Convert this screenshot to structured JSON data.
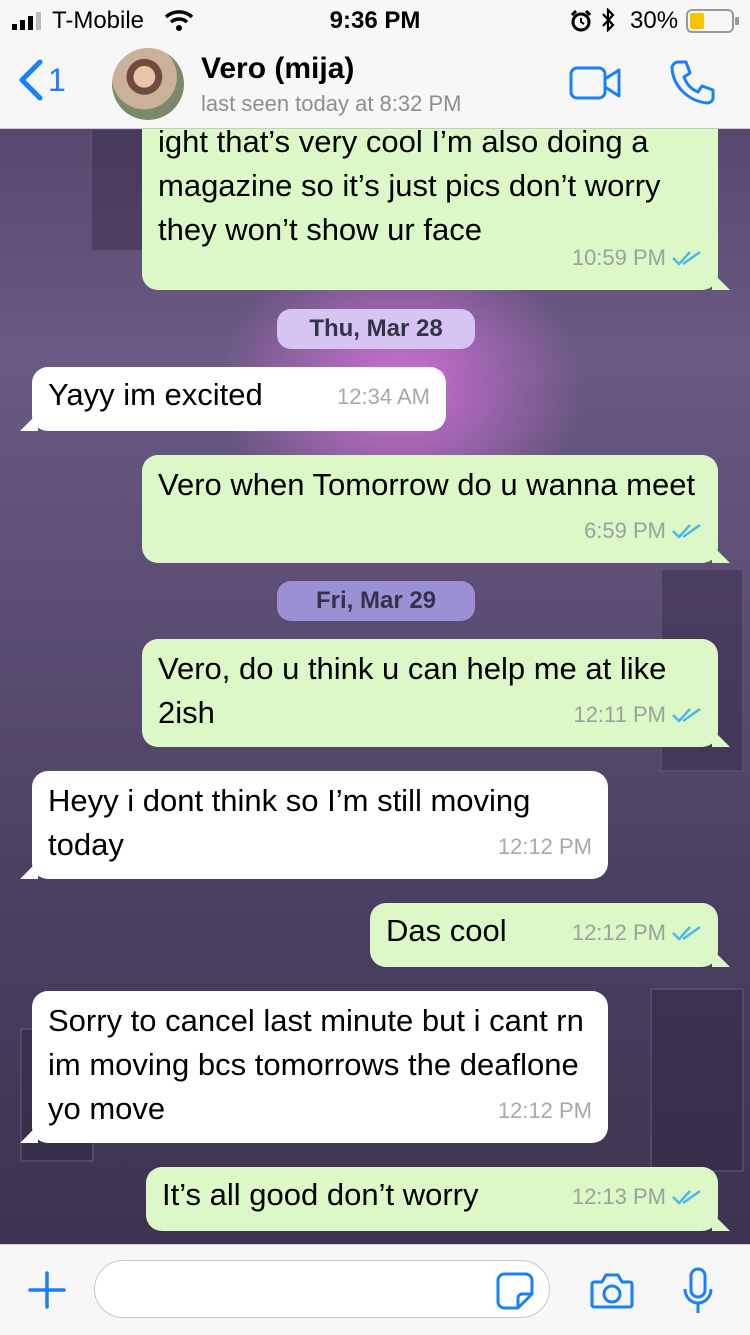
{
  "status_bar": {
    "carrier": "T-Mobile",
    "time": "9:36 PM",
    "battery": "30%"
  },
  "header": {
    "back_count": "1",
    "contact_name": "Vero (mija)",
    "last_seen": "last seen today at 8:32 PM"
  },
  "messages": [
    {
      "text": "ight that’s very cool I’m also doing a magazine so it’s just pics don’t worry they won’t show ur face",
      "time": "10:59 PM"
    },
    {
      "text": "Yayy im excited",
      "time": "12:34 AM"
    },
    {
      "text": "Vero when Tomorrow do u wanna meet",
      "time": "6:59 PM"
    },
    {
      "text": "Vero, do u think u can help me at like 2ish",
      "time": "12:11 PM"
    },
    {
      "text": "Heyy i dont think so I’m still moving today",
      "time": "12:12 PM"
    },
    {
      "text": "Das cool",
      "time": "12:12 PM"
    },
    {
      "text": "Sorry to cancel last minute but i cant rn im moving bcs tomorrows the deaflone yo move",
      "time": "12:12 PM"
    },
    {
      "text": "It’s all good don’t worry",
      "time": "12:13 PM"
    }
  ],
  "date_separators": [
    "Thu, Mar 28",
    "Fri, Mar 29"
  ],
  "input": {
    "placeholder": ""
  },
  "colors": {
    "accent": "#1a7ffb",
    "outgoing_bubble": "#dcf8c6",
    "incoming_bubble": "#ffffff",
    "read_ticks": "#4fb6ec"
  }
}
